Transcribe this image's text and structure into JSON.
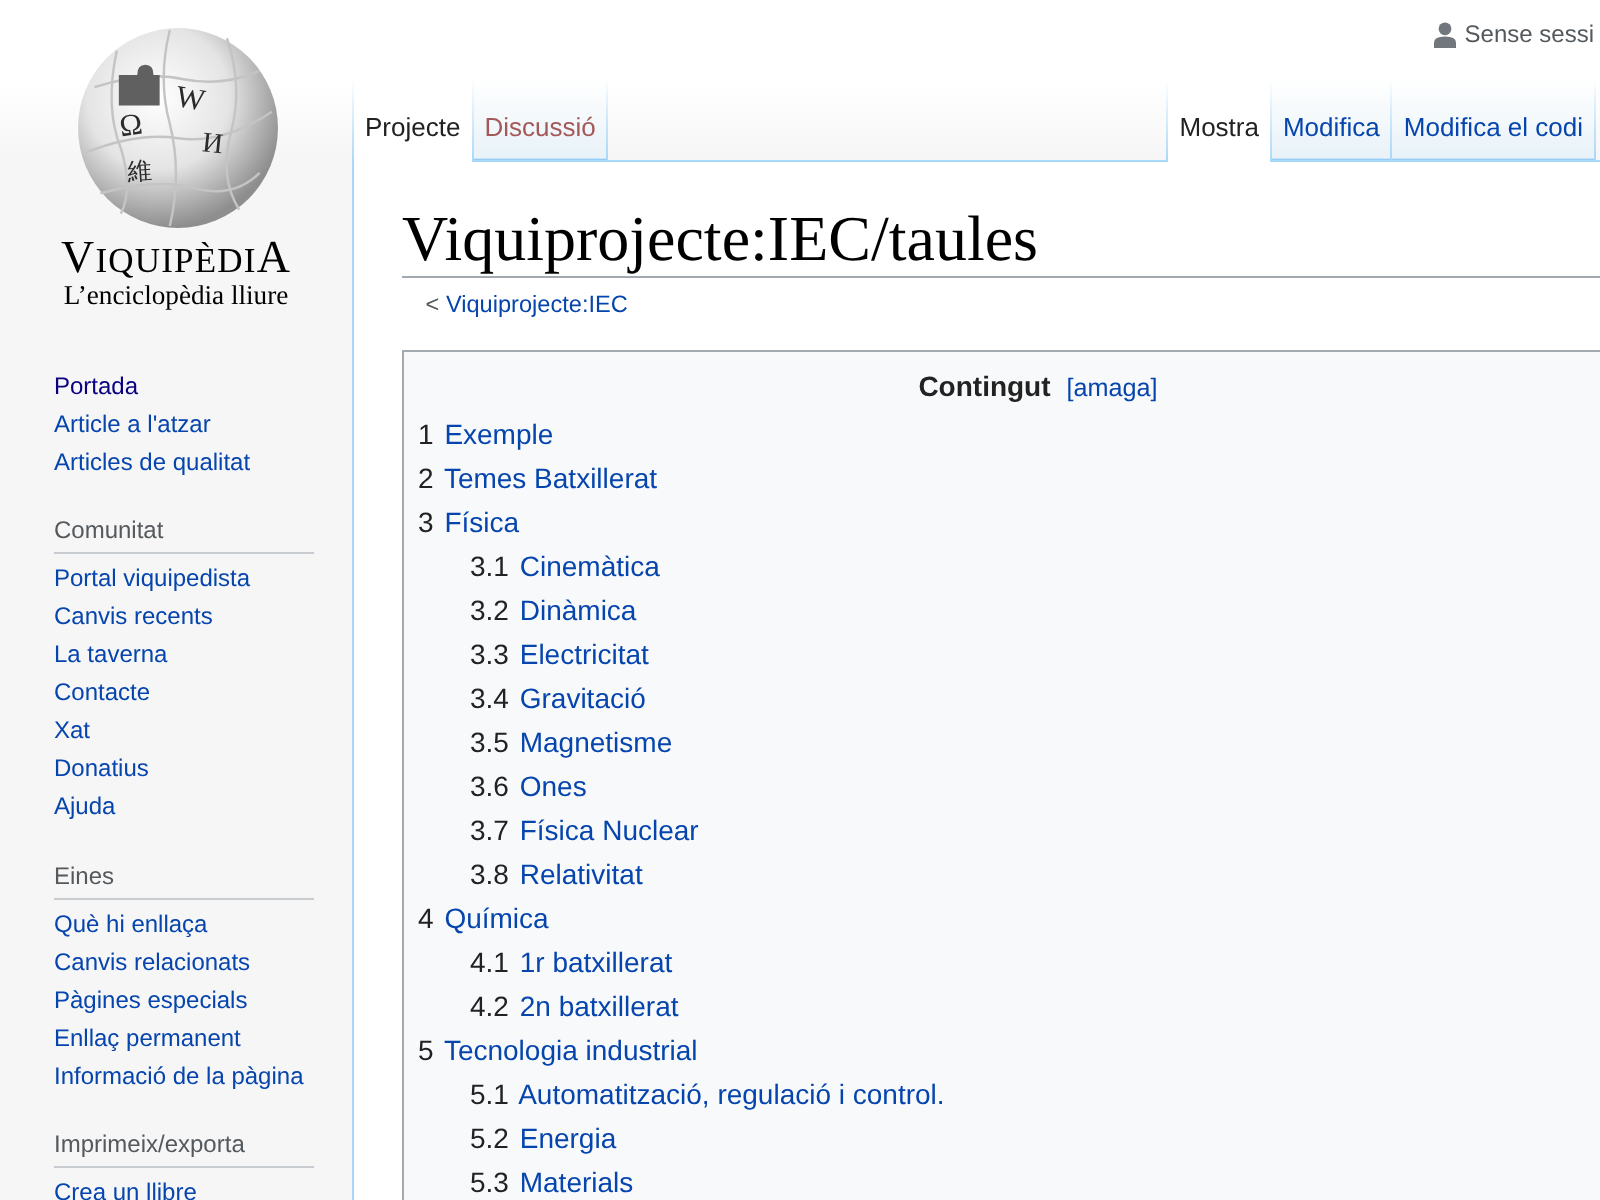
{
  "logo": {
    "glyphs": [
      "Ω",
      "W",
      "И",
      "維"
    ],
    "wordmark": "VIQUIPÈDIA",
    "tagline": "L’enciclopèdia lliure"
  },
  "personal_bar": {
    "user_status": "Sense sessi"
  },
  "tabs_left": [
    {
      "label": "Projecte",
      "selected": true,
      "missing": false
    },
    {
      "label": "Discussió",
      "selected": false,
      "missing": true
    }
  ],
  "tabs_right": [
    {
      "label": "Mostra",
      "selected": true
    },
    {
      "label": "Modifica",
      "selected": false
    },
    {
      "label": "Modifica el codi",
      "selected": false
    }
  ],
  "sidebar": {
    "sections": [
      {
        "items": [
          {
            "label": "Portada",
            "visited": true
          },
          {
            "label": "Article a l'atzar",
            "visited": false
          },
          {
            "label": "Articles de qualitat",
            "visited": false
          }
        ]
      },
      {
        "heading": "Comunitat",
        "items": [
          {
            "label": "Portal viquipedista",
            "visited": false
          },
          {
            "label": "Canvis recents",
            "visited": false
          },
          {
            "label": "La taverna",
            "visited": false
          },
          {
            "label": "Contacte",
            "visited": false
          },
          {
            "label": "Xat",
            "visited": false
          },
          {
            "label": "Donatius",
            "visited": false
          },
          {
            "label": "Ajuda",
            "visited": false
          }
        ]
      },
      {
        "heading": "Eines",
        "items": [
          {
            "label": "Què hi enllaça",
            "visited": false
          },
          {
            "label": "Canvis relacionats",
            "visited": false
          },
          {
            "label": "Pàgines especials",
            "visited": false
          },
          {
            "label": "Enllaç permanent",
            "visited": false
          },
          {
            "label": "Informació de la pàgina",
            "visited": false
          }
        ]
      },
      {
        "heading": "Imprimeix/exporta",
        "items": [
          {
            "label": "Crea un llibre",
            "visited": false
          }
        ]
      }
    ]
  },
  "page": {
    "title": "Viquiprojecte:IEC/taules",
    "breadcrumb": {
      "marker": "<",
      "link": "Viquiprojecte:IEC"
    },
    "toc": {
      "title": "Contingut",
      "toggle": "[amaga]",
      "entries": [
        {
          "number": "1",
          "label": "Exemple"
        },
        {
          "number": "2",
          "label": "Temes Batxillerat"
        },
        {
          "number": "3",
          "label": "Física",
          "children": [
            {
              "number": "3.1",
              "label": "Cinemàtica"
            },
            {
              "number": "3.2",
              "label": "Dinàmica"
            },
            {
              "number": "3.3",
              "label": "Electricitat"
            },
            {
              "number": "3.4",
              "label": "Gravitació"
            },
            {
              "number": "3.5",
              "label": "Magnetisme"
            },
            {
              "number": "3.6",
              "label": "Ones"
            },
            {
              "number": "3.7",
              "label": "Física Nuclear"
            },
            {
              "number": "3.8",
              "label": "Relativitat"
            }
          ]
        },
        {
          "number": "4",
          "label": "Química",
          "children": [
            {
              "number": "4.1",
              "label": "1r batxillerat"
            },
            {
              "number": "4.2",
              "label": "2n batxillerat"
            }
          ]
        },
        {
          "number": "5",
          "label": "Tecnologia industrial",
          "children": [
            {
              "number": "5.1",
              "label": "Automatització, regulació i control."
            },
            {
              "number": "5.2",
              "label": "Energia"
            },
            {
              "number": "5.3",
              "label": "Materials"
            }
          ]
        }
      ]
    }
  }
}
